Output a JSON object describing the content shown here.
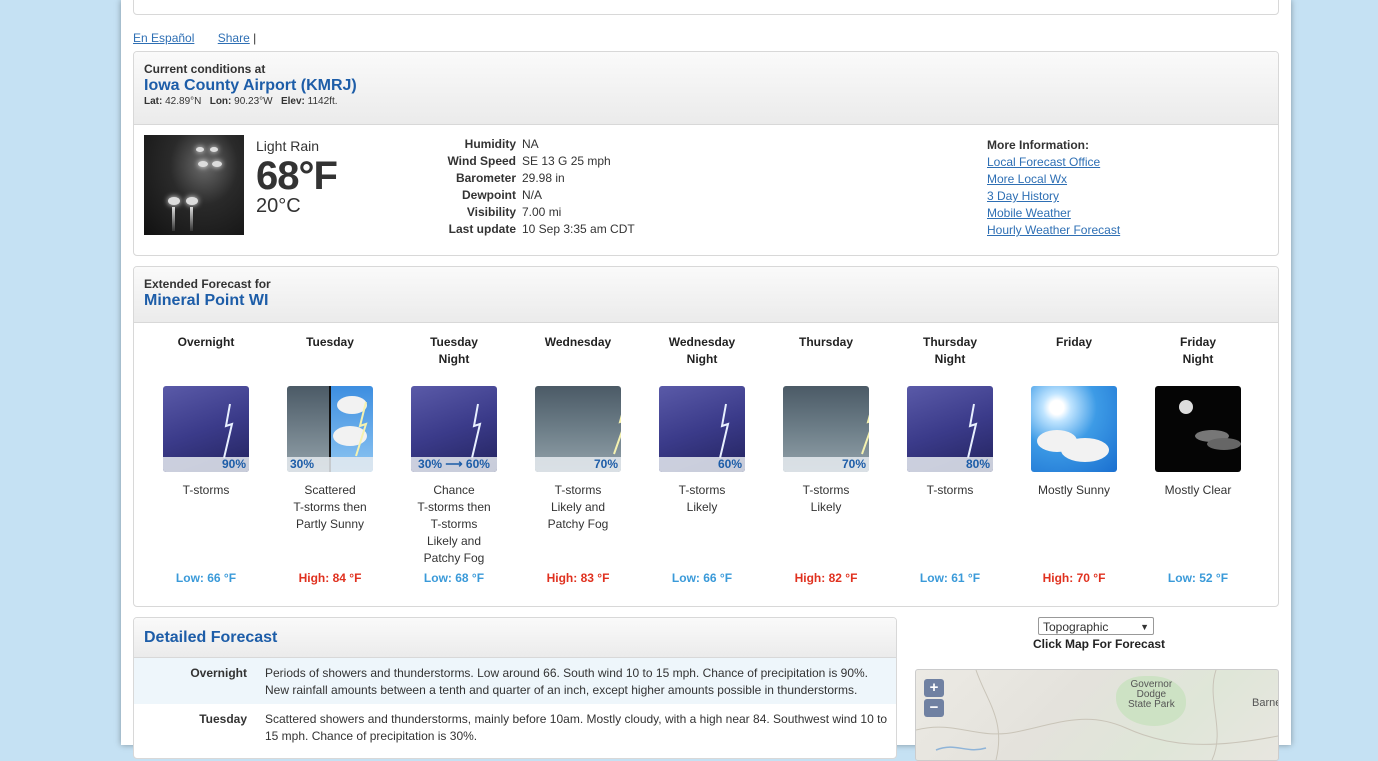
{
  "links": {
    "spanish": "En Español",
    "share": "Share",
    "separator": "|"
  },
  "current": {
    "header_small": "Current conditions at",
    "station": "Iowa County Airport (KMRJ)",
    "lat_label": "Lat:",
    "lat": "42.89°N",
    "lon_label": "Lon:",
    "lon": "90.23°W",
    "elev_label": "Elev:",
    "elev": "1142ft.",
    "description": "Light Rain",
    "temp_f": "68°F",
    "temp_c": "20°C",
    "details": [
      {
        "label": "Humidity",
        "value": "NA"
      },
      {
        "label": "Wind Speed",
        "value": "SE 13 G 25 mph"
      },
      {
        "label": "Barometer",
        "value": "29.98 in"
      },
      {
        "label": "Dewpoint",
        "value": "N/A"
      },
      {
        "label": "Visibility",
        "value": "7.00 mi"
      },
      {
        "label": "Last update",
        "value": "10 Sep 3:35 am CDT"
      }
    ],
    "more_title": "More Information:",
    "more_links": [
      "Local Forecast Office",
      "More Local Wx",
      "3 Day History",
      "Mobile Weather",
      "Hourly Weather Forecast"
    ]
  },
  "extended": {
    "header_small": "Extended Forecast for",
    "location": "Mineral Point WI",
    "periods": [
      {
        "line1": "Overnight",
        "line2": "",
        "icon": "thunderstorm-icon",
        "pop": "90%",
        "short": [
          "T-storms"
        ],
        "temp": "Low: 66 °F",
        "kind": "lo"
      },
      {
        "line1": "Tuesday",
        "line2": "",
        "icon": "storm-then-sunny-icon",
        "pop": "30%",
        "short": [
          "Scattered",
          "T-storms then",
          "Partly Sunny"
        ],
        "temp": "High: 84 °F",
        "kind": "hi"
      },
      {
        "line1": "Tuesday",
        "line2": "Night",
        "icon": "thunderstorm-icon",
        "pop": "30% ⟶ 60%",
        "short": [
          "Chance",
          "T-storms then",
          "T-storms",
          "Likely and",
          "Patchy Fog"
        ],
        "temp": "Low: 68 °F",
        "kind": "lo"
      },
      {
        "line1": "Wednesday",
        "line2": "",
        "icon": "day-thunderstorm-icon",
        "pop": "70%",
        "short": [
          "T-storms",
          "Likely and",
          "Patchy Fog"
        ],
        "temp": "High: 83 °F",
        "kind": "hi"
      },
      {
        "line1": "Wednesday",
        "line2": "Night",
        "icon": "thunderstorm-icon",
        "pop": "60%",
        "short": [
          "T-storms",
          "Likely"
        ],
        "temp": "Low: 66 °F",
        "kind": "lo"
      },
      {
        "line1": "Thursday",
        "line2": "",
        "icon": "day-thunderstorm-icon",
        "pop": "70%",
        "short": [
          "T-storms",
          "Likely"
        ],
        "temp": "High: 82 °F",
        "kind": "hi"
      },
      {
        "line1": "Thursday",
        "line2": "Night",
        "icon": "thunderstorm-icon",
        "pop": "80%",
        "short": [
          "T-storms"
        ],
        "temp": "Low: 61 °F",
        "kind": "lo"
      },
      {
        "line1": "Friday",
        "line2": "",
        "icon": "sunny-icon",
        "pop": "",
        "short": [
          "Mostly Sunny"
        ],
        "temp": "High: 70 °F",
        "kind": "hi"
      },
      {
        "line1": "Friday",
        "line2": "Night",
        "icon": "clear-night-icon",
        "pop": "",
        "short": [
          "Mostly Clear"
        ],
        "temp": "Low: 52 °F",
        "kind": "lo"
      }
    ]
  },
  "detailed": {
    "title": "Detailed Forecast",
    "rows": [
      {
        "label": "Overnight",
        "text": "Periods of showers and thunderstorms. Low around 66. South wind 10 to 15 mph. Chance of precipitation is 90%. New rainfall amounts between a tenth and quarter of an inch, except higher amounts possible in thunderstorms."
      },
      {
        "label": "Tuesday",
        "text": "Scattered showers and thunderstorms, mainly before 10am. Mostly cloudy, with a high near 84. Southwest wind 10 to 15 mph. Chance of precipitation is 30%."
      }
    ]
  },
  "map": {
    "select_value": "Topographic",
    "caption": "Click Map For Forecast",
    "zoom_in": "+",
    "zoom_out": "−",
    "place_labels": [
      "Governor",
      "Dodge",
      "State Park",
      "Barne"
    ]
  }
}
